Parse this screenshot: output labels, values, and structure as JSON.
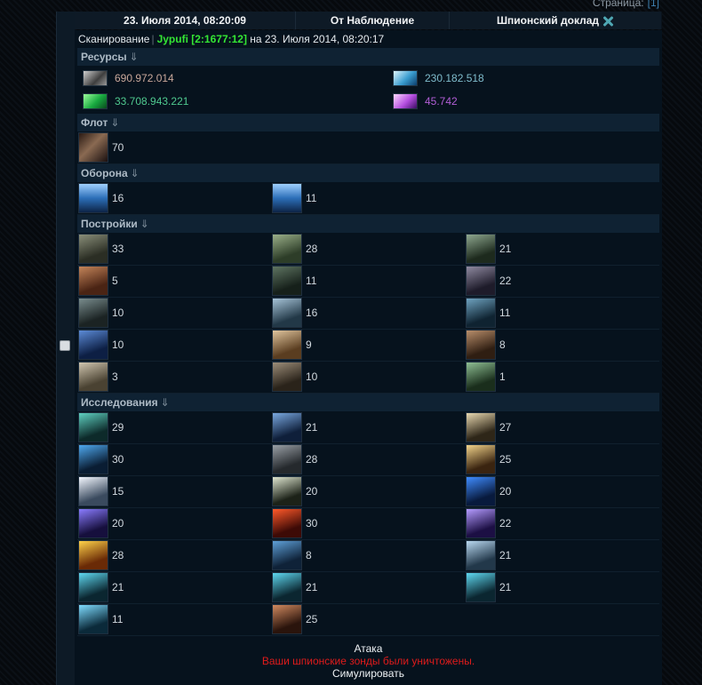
{
  "pager": {
    "label": "Страница:",
    "page": "[1]"
  },
  "message": {
    "date": "23. Июля 2014, 08:20:09",
    "from": "От Наблюдение",
    "subject": "Шпионский доклад"
  },
  "scan": {
    "prefix": "Сканирование",
    "separator": "|",
    "player": "Jypufi [2:1677:12]",
    "suffix": "на 23. Июля 2014, 08:20:17"
  },
  "sections": {
    "resources": "Ресурсы",
    "fleet": "Флот",
    "defense": "Оборона",
    "buildings": "Постройки",
    "research": "Исследования",
    "arrow": "⇓"
  },
  "resources": [
    {
      "icon": "metal-icon",
      "value": "690.972.014",
      "color": "#c9a89b"
    },
    {
      "icon": "crystal-icon",
      "value": "230.182.518",
      "color": "#7fbccc"
    },
    {
      "icon": "deuterium-icon",
      "value": "33.708.943.221",
      "color": "#4fc98f"
    },
    {
      "icon": "dark-matter-icon",
      "value": "45.742",
      "color": "#b15ed6"
    }
  ],
  "fleet": [
    {
      "icon": "ship-icon",
      "value": "70"
    }
  ],
  "defense": [
    {
      "icon": "defense-icon",
      "value": "16"
    },
    {
      "icon": "defense-icon",
      "value": "11"
    }
  ],
  "buildings": [
    "33",
    "28",
    "21",
    "5",
    "11",
    "22",
    "10",
    "16",
    "11",
    "10",
    "9",
    "8",
    "3",
    "10",
    "1"
  ],
  "research": [
    "29",
    "21",
    "27",
    "30",
    "28",
    "25",
    "15",
    "20",
    "20",
    "20",
    "30",
    "22",
    "28",
    "8",
    "21",
    "21",
    "21",
    "21",
    "11",
    "25"
  ],
  "footer": {
    "attack": "Атака",
    "warning": "Ваши шпионские зонды были уничтожены.",
    "simulate": "Симулировать"
  },
  "colors": {
    "accent": "#34e534",
    "warning": "#e01b1b",
    "header_bg": "#0e1a26",
    "section_bg": "#0f2233"
  }
}
